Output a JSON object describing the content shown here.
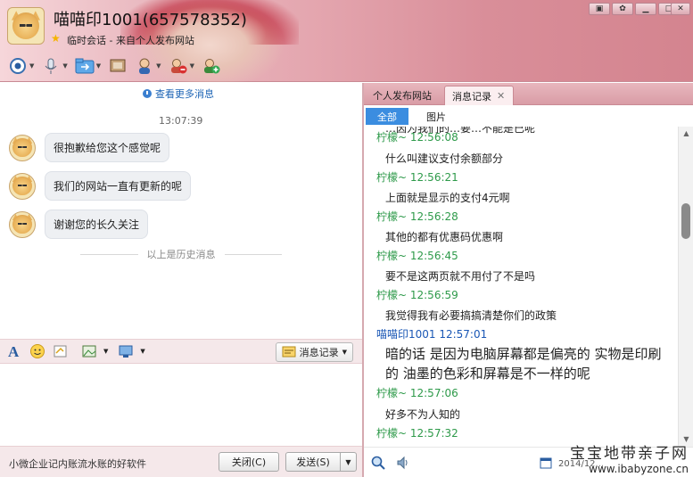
{
  "header": {
    "title": "喵喵印1001(657578352)",
    "subtitle": "临时会话 - 来自个人发布网站",
    "window_controls": [
      "minimize-menu",
      "skin",
      "minimize",
      "maximize",
      "close"
    ]
  },
  "toolbar": {
    "icons": [
      "video-icon",
      "voice-icon",
      "file-transfer-icon",
      "screen-share-icon",
      "remote-assist-icon",
      "block-user-icon",
      "add-friend-icon"
    ]
  },
  "chat": {
    "more_link": "查看更多消息",
    "timestamp": "13:07:39",
    "messages": [
      {
        "text": "很抱歉给您这个感觉呢"
      },
      {
        "text": "我们的网站一直有更新的呢"
      },
      {
        "text": "谢谢您的长久关注"
      }
    ],
    "history_separator": "以上是历史消息"
  },
  "input_toolbar": {
    "history_button": "消息记录"
  },
  "bottom": {
    "ad_text": "小微企业记内账流水账的好软件",
    "close_button": "关闭(C)",
    "send_button": "发送(S)"
  },
  "right_panel": {
    "tabs": [
      "个人发布网站",
      "消息记录"
    ],
    "filters": {
      "all": "全部",
      "images": "图片"
    },
    "partial_top_line": "…因为我们的…要…不能是已呢",
    "log": [
      {
        "sender": "柠檬~ 12:56:08",
        "text": "什么叫建议支付余额部分",
        "self": false
      },
      {
        "sender": "柠檬~ 12:56:21",
        "text": "上面就是显示的支付4元啊",
        "self": false
      },
      {
        "sender": "柠檬~ 12:56:28",
        "text": "其他的都有优惠码优惠啊",
        "self": false
      },
      {
        "sender": "柠檬~ 12:56:45",
        "text": "要不是这两页就不用付了不是吗",
        "self": false
      },
      {
        "sender": "柠檬~ 12:56:59",
        "text": "我觉得我有必要搞搞清楚你们的政策",
        "self": false
      },
      {
        "sender": "喵喵印1001 12:57:01",
        "text": "暗的话 是因为电脑屏幕都是偏亮的 实物是印刷的 油墨的色彩和屏幕是不一样的呢",
        "self": true
      },
      {
        "sender": "柠檬~ 12:57:06",
        "text": "好多不为人知的",
        "self": false
      },
      {
        "sender": "柠檬~ 12:57:32",
        "text": "",
        "self": false
      }
    ],
    "date_partial": "2014/12..."
  },
  "watermark": {
    "title": "宝宝地带亲子网",
    "url": "www.ibabyzone.cn"
  },
  "colors": {
    "header_pink": "#e4a6af",
    "accent_blue": "#3b8de0",
    "sender_green": "#2e9a4a",
    "self_blue": "#1a57b5"
  }
}
